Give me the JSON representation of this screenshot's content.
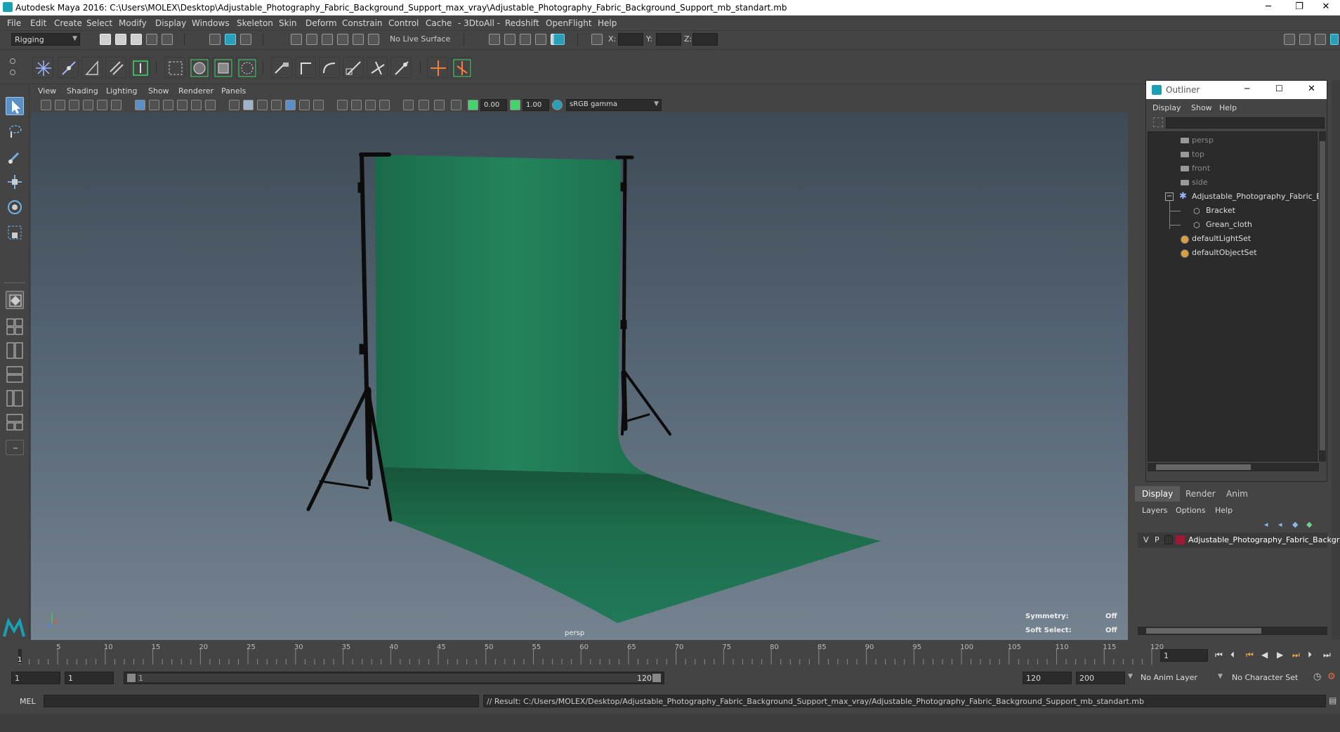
{
  "window": {
    "title": "Autodesk Maya 2016: C:\\Users\\MOLEX\\Desktop\\Adjustable_Photography_Fabric_Background_Support_max_vray\\Adjustable_Photography_Fabric_Background_Support_mb_standart.mb",
    "minimize": "─",
    "restore": "❐",
    "close": "✕"
  },
  "menubar": [
    "File",
    "Edit",
    "Create",
    "Select",
    "Modify",
    "Display",
    "Windows",
    "Skeleton",
    "Skin",
    "Deform",
    "Constrain",
    "Control",
    "Cache",
    "- 3DtoAll -",
    "Redshift",
    "OpenFlight",
    "Help"
  ],
  "statusline": {
    "menuset": "Rigging",
    "live_surface": "No Live Surface",
    "x_label": "X:",
    "y_label": "Y:",
    "z_label": "Z:"
  },
  "viewport": {
    "menus": [
      "View",
      "Shading",
      "Lighting",
      "Show",
      "Renderer",
      "Panels"
    ],
    "exposure": "0.00",
    "gamma": "1.00",
    "color_space": "sRGB gamma",
    "camera_label": "persp",
    "symmetry_label": "Symmetry:",
    "symmetry_value": "Off",
    "soft_select_label": "Soft Select:",
    "soft_select_value": "Off"
  },
  "outliner": {
    "title": "Outliner",
    "menus": [
      "Display",
      "Show",
      "Help"
    ],
    "items": [
      {
        "label": "persp",
        "dim": true
      },
      {
        "label": "top",
        "dim": true
      },
      {
        "label": "front",
        "dim": true
      },
      {
        "label": "side",
        "dim": true
      },
      {
        "label": "Adjustable_Photography_Fabric_Ba",
        "dim": false
      },
      {
        "label": "Bracket",
        "dim": false
      },
      {
        "label": "Grean_cloth",
        "dim": false
      },
      {
        "label": "defaultLightSet",
        "dim": false
      },
      {
        "label": "defaultObjectSet",
        "dim": false
      }
    ]
  },
  "layers": {
    "tabs": [
      "Display",
      "Render",
      "Anim"
    ],
    "menus": [
      "Layers",
      "Options",
      "Help"
    ],
    "layer_v": "V",
    "layer_p": "P",
    "layer_name": "Adjustable_Photography_Fabric_Backgr",
    "layer_color": "#9b1b35"
  },
  "timeslider": {
    "ticks": [
      "5",
      "10",
      "15",
      "20",
      "25",
      "30",
      "35",
      "40",
      "45",
      "50",
      "55",
      "60",
      "65",
      "70",
      "75",
      "80",
      "85",
      "90",
      "95",
      "100",
      "105",
      "110",
      "115",
      "120"
    ],
    "current_frame_marker": "1",
    "current_frame": "1"
  },
  "range": {
    "start": "1",
    "playback_start": "1",
    "slider_start": "1",
    "slider_end": "120",
    "playback_end": "120",
    "end": "200",
    "anim_layer": "No Anim Layer",
    "character_set": "No Character Set"
  },
  "cmdline": {
    "lang": "MEL",
    "result": "// Result: C:/Users/MOLEX/Desktop/Adjustable_Photography_Fabric_Background_Support_max_vray/Adjustable_Photography_Fabric_Background_Support_mb_standart.mb"
  },
  "colors": {
    "cloth": "#1f7a55",
    "accent": "#2c9fb8"
  }
}
